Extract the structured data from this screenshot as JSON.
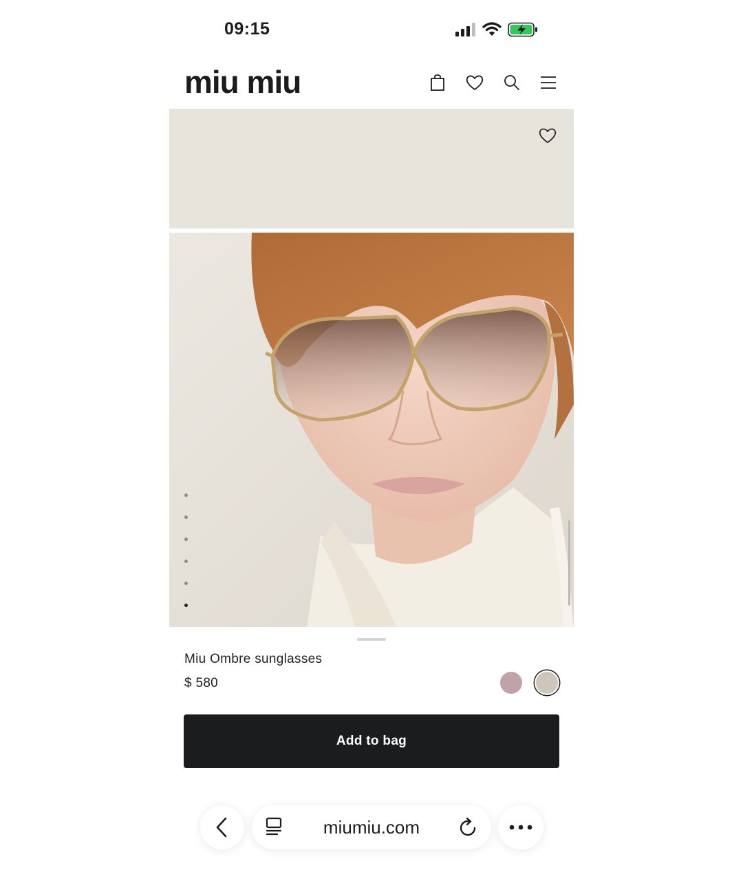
{
  "status_bar": {
    "time": "09:15",
    "signal_icon": "cellular-signal-icon",
    "wifi_icon": "wifi-icon",
    "battery_icon": "battery-charging-icon",
    "battery_color": "#34c759"
  },
  "header": {
    "brand": "miu miu",
    "icons": [
      "shopping-bag-icon",
      "heart-icon",
      "search-icon",
      "menu-icon"
    ]
  },
  "product": {
    "name": "Miu Ombre sunglasses",
    "price": "$ 580",
    "image_count": 6,
    "active_image_index": 5,
    "color_swatches": [
      {
        "name": "pink",
        "color": "#bfa3a7",
        "selected": false
      },
      {
        "name": "beige",
        "color": "#cfc6bb",
        "selected": true
      }
    ],
    "wishlist_icon": "heart-outline-icon"
  },
  "actions": {
    "add_to_bag_label": "Add to bag"
  },
  "browser": {
    "url": "miumiu.com",
    "icons": [
      "back-chevron-icon",
      "tabs-icon",
      "reload-icon",
      "more-icon"
    ]
  },
  "colors": {
    "button_bg": "#1b1c1e",
    "panel_bg": "#e7e4db"
  }
}
